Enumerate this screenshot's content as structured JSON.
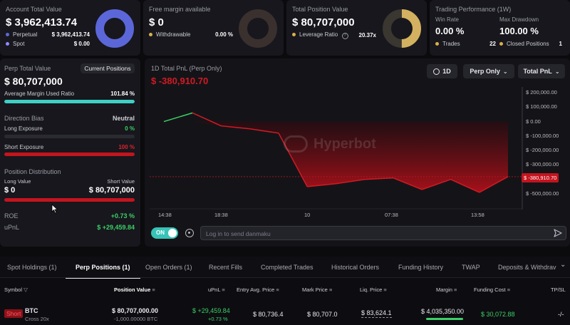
{
  "summary": {
    "account": {
      "label": "Account Total Value",
      "value": "$ 3,962,413.74",
      "perp_label": "Perpetual",
      "perp_value": "$ 3,962,413.74",
      "spot_label": "Spot",
      "spot_value": "$ 0.00",
      "perp_color": "#5b67d8",
      "spot_color": "#8c8cff"
    },
    "margin": {
      "label": "Free margin available",
      "value": "$ 0",
      "withdrawable_label": "Withdrawable",
      "withdrawable_value": "0.00 %"
    },
    "position": {
      "label": "Total Position Value",
      "value": "$ 80,707,000",
      "leverage_label": "Leverage Ratio",
      "leverage_value": "20.37x",
      "help_icon": "help-icon"
    },
    "performance": {
      "label": "Trading Performance (1W)",
      "win_rate_label": "Win Rate",
      "win_rate_value": "0.00 %",
      "max_dd_label": "Max Drawdown",
      "max_dd_value": "100.00 %",
      "trades_label": "Trades",
      "trades_value": "22",
      "closed_label": "Closed Positions",
      "closed_value": "1"
    }
  },
  "perp_panel": {
    "label": "Perp Total Value",
    "value": "$ 80,707,000",
    "button": "Current Positions",
    "avg_margin_label": "Average Margin Used Ratio",
    "avg_margin_value": "101.84 %",
    "avg_margin_fraction": 1.0,
    "direction_label": "Direction Bias",
    "direction_value": "Neutral",
    "long_exposure_label": "Long Exposure",
    "long_exposure_value": "0 %",
    "long_exposure_fraction": 0,
    "short_exposure_label": "Short Exposure",
    "short_exposure_value": "100 %",
    "short_exposure_fraction": 1.0,
    "distribution_label": "Position Distribution",
    "long_value_label": "Long Value",
    "short_value_label": "Short Value",
    "long_value": "$ 0",
    "short_value": "$ 80,707,000",
    "roe_label": "ROE",
    "roe_value": "+0.73 %",
    "upnl_label": "uPnL",
    "upnl_value": "$ +29,459.84"
  },
  "pnl_chart": {
    "title": "1D Total PnL (Perp Only)",
    "current_value": "$ -380,910.70",
    "period_button": "1D",
    "filter_button": "Perp Only",
    "metric_button": "Total PnL",
    "watermark": "Hyperbot",
    "toggle_label": "ON",
    "danmaku_placeholder": "Log in to send danmaku",
    "accent_green": "#3ccf67",
    "accent_red": "#d11a24"
  },
  "chart_data": {
    "type": "area",
    "title": "1D Total PnL (Perp Only)",
    "x_ticks": [
      "14:38",
      "18:38",
      "10",
      "07:38",
      "13:58"
    ],
    "y_ticks": [
      "$ 200,000.00",
      "$ 100,000.00",
      "$ 0.00",
      "$ -100,000.00",
      "$ -200,000.00",
      "$ -300,000.00",
      "$ -400,000.00",
      "$ -500,000.00"
    ],
    "ylim": [
      -500000,
      200000
    ],
    "current_label": "$ -380,910.70",
    "series": [
      {
        "values": [
          0,
          60000,
          -30000,
          -50000,
          -80000,
          -450000,
          -430000,
          -400000,
          -390000,
          -470000,
          -400000,
          -490000,
          -380910.7
        ]
      }
    ]
  },
  "tabs": {
    "items": [
      "Spot Holdings (1)",
      "Perp Positions (1)",
      "Open Orders (1)",
      "Recent Fills",
      "Completed Trades",
      "Historical Orders",
      "Funding History",
      "TWAP",
      "Deposits & Withdrav"
    ],
    "active_index": 1
  },
  "table": {
    "headers": {
      "symbol": "Symbol",
      "position_value": "Position Value",
      "upnl": "uPnL",
      "entry": "Entry Avg. Price",
      "mark": "Mark Price",
      "liq": "Liq. Price",
      "margin": "Margin",
      "funding": "Funding Cost",
      "tpsl": "TP/SL"
    },
    "row": {
      "side": "Short",
      "symbol": "BTC",
      "mode": "Cross 20x",
      "position_value": "$ 80,707,000.00",
      "position_size": "-1,000.00000 BTC",
      "upnl": "$ +29,459.84",
      "upnl_pct": "+0.73 %",
      "entry": "$ 80,736.4",
      "mark": "$ 80,707.0",
      "liq": "$ 83,624.1",
      "margin": "$ 4,035,350.00",
      "funding": "$ 30,072.88",
      "tpsl": "-/-"
    }
  }
}
